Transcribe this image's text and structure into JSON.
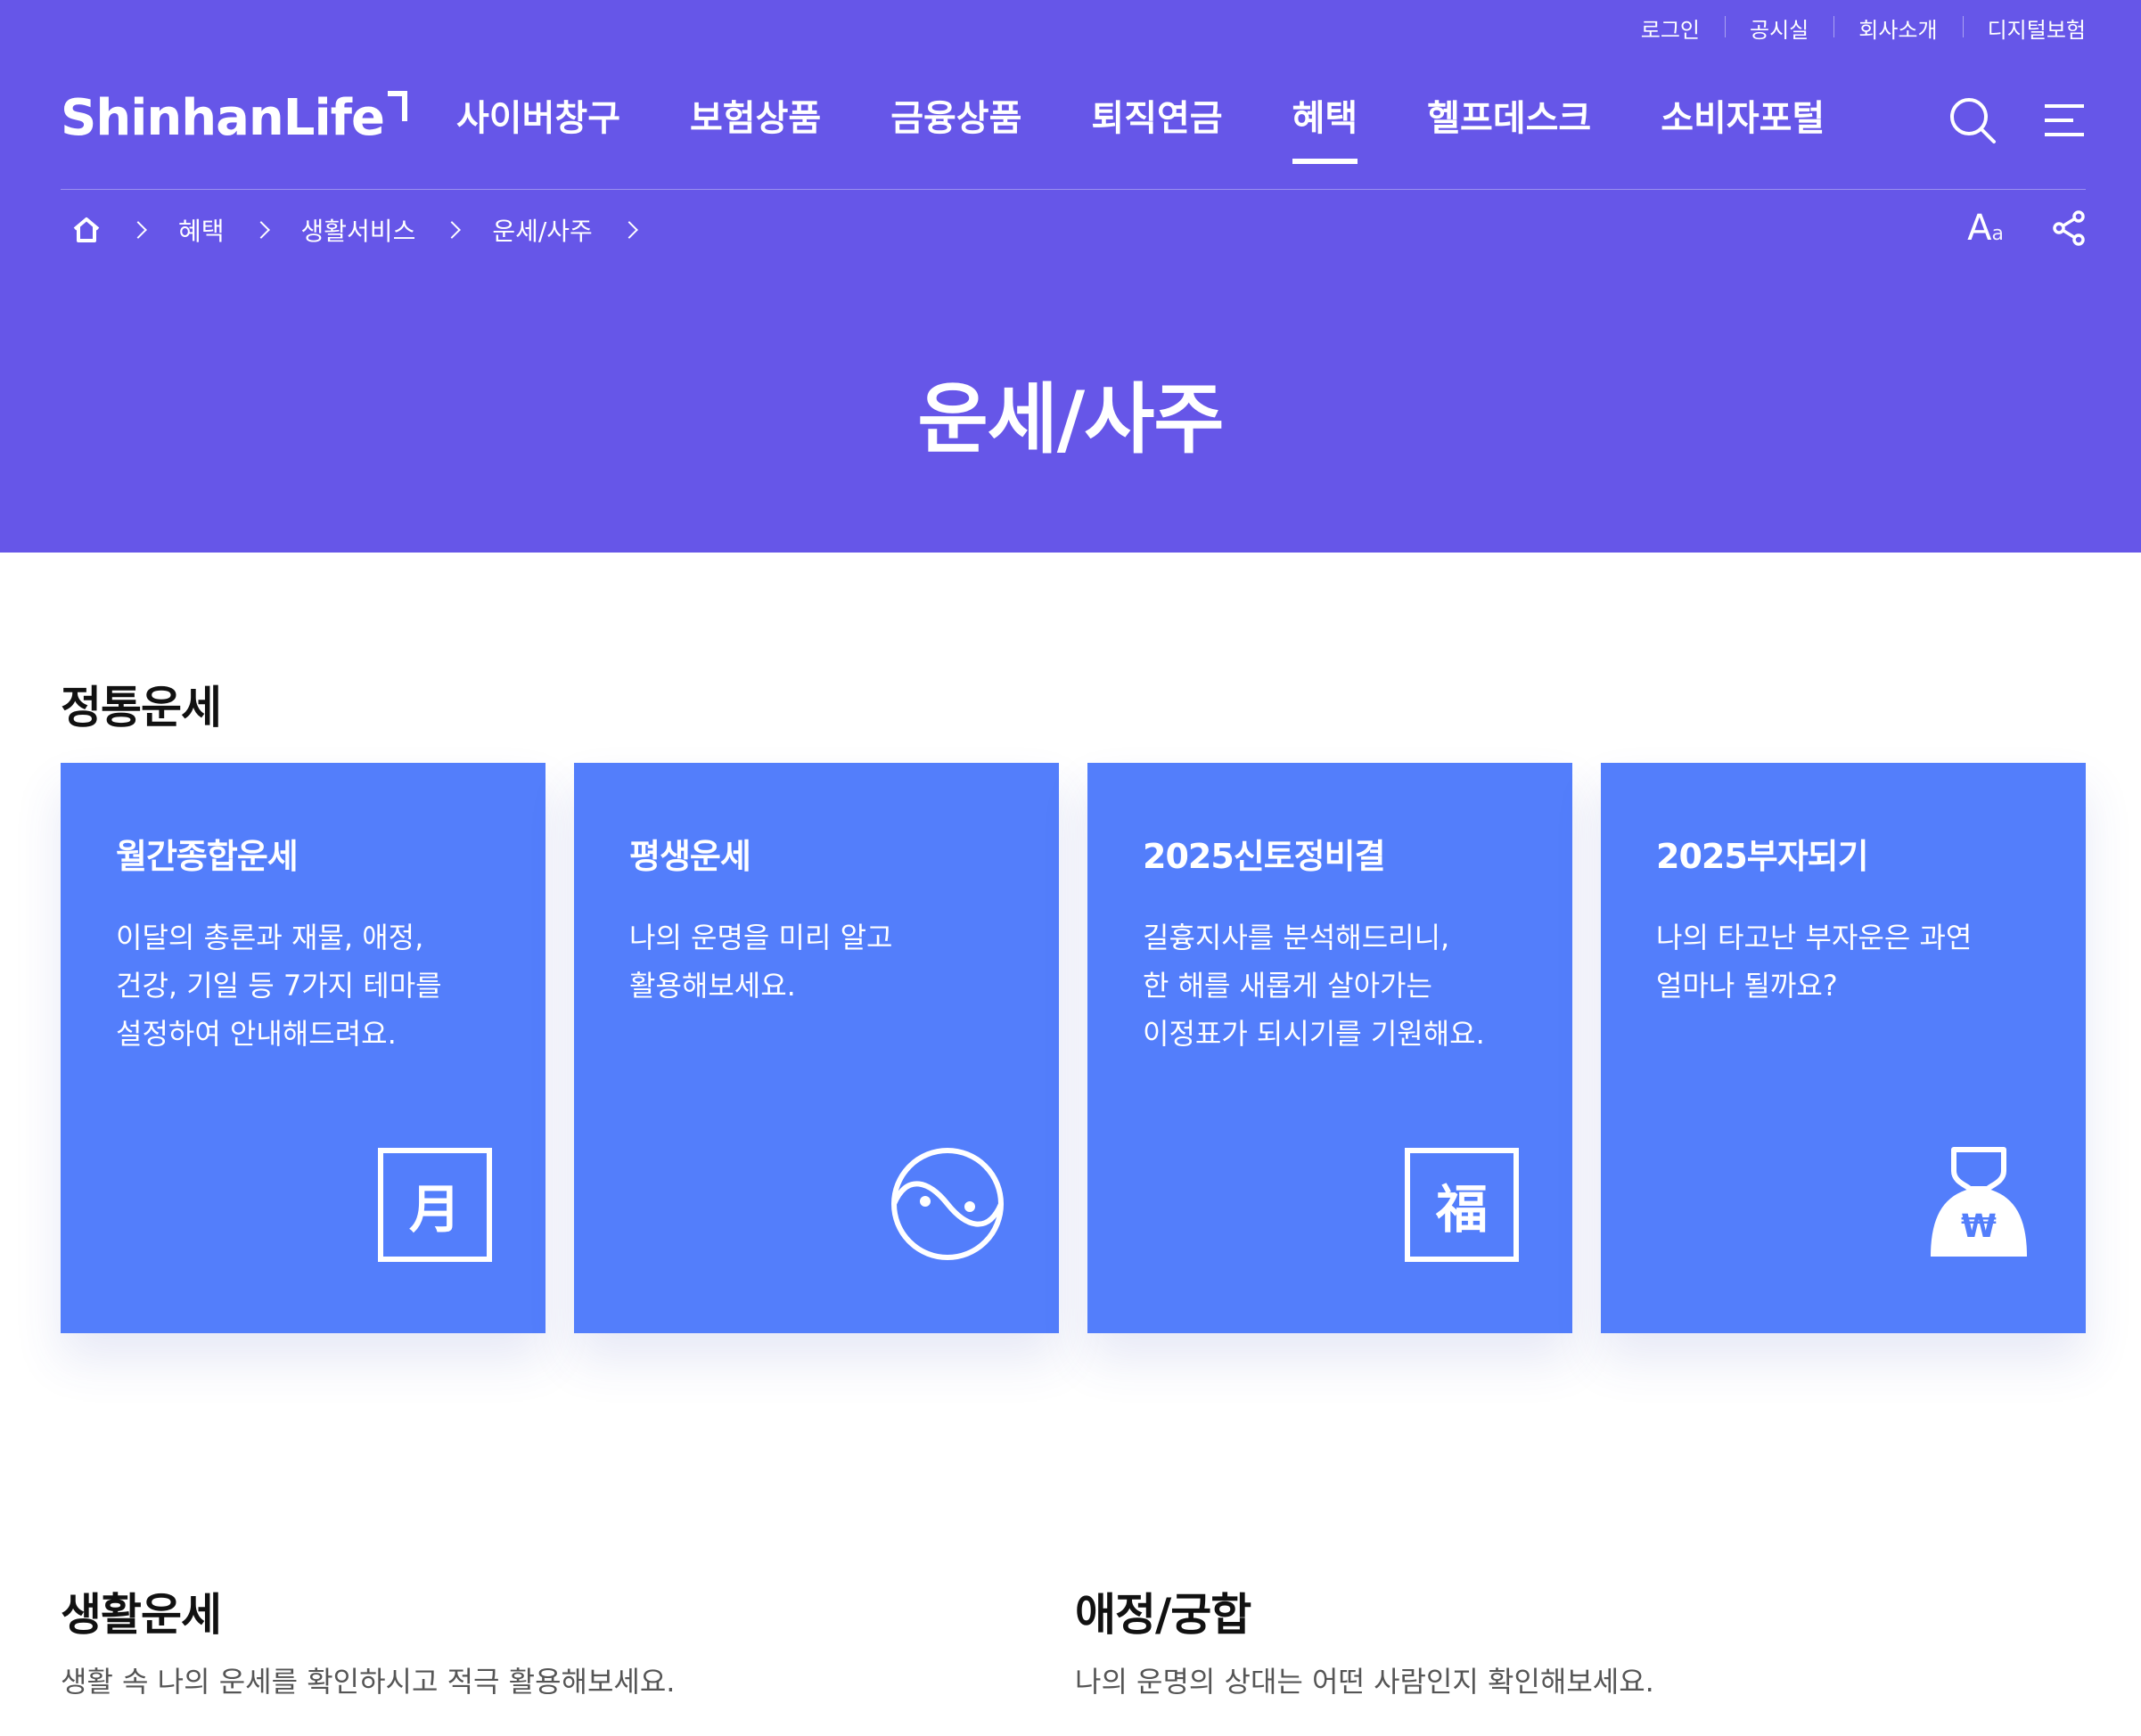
{
  "util_links": [
    "로그인",
    "공시실",
    "회사소개",
    "디지털보험"
  ],
  "logo": {
    "text": "ShinhanLife"
  },
  "nav": [
    {
      "label": "사이버창구",
      "active": false
    },
    {
      "label": "보험상품",
      "active": false
    },
    {
      "label": "금융상품",
      "active": false
    },
    {
      "label": "퇴직연금",
      "active": false
    },
    {
      "label": "혜택",
      "active": true
    },
    {
      "label": "헬프데스크",
      "active": false
    },
    {
      "label": "소비자포털",
      "active": false
    }
  ],
  "icons": {
    "search": "search-icon",
    "menu": "menu-icon",
    "home": "home-icon",
    "font_size": "font-size-icon",
    "share": "share-icon"
  },
  "breadcrumb": [
    "혜택",
    "생활서비스",
    "운세/사주"
  ],
  "font_size_label": {
    "big": "A",
    "small": "a"
  },
  "page_title": "운세/사주",
  "sections": {
    "traditional": {
      "title": "정통운세"
    },
    "life": {
      "title": "생활운세",
      "desc": "생활 속 나의 운세를 확인하시고 적극 활용해보세요."
    },
    "love": {
      "title": "애정/궁합",
      "desc": "나의 운명의 상대는 어떤 사람인지 확인해보세요."
    }
  },
  "cards": [
    {
      "title": "월간종합운세",
      "lines": [
        "이달의 총론과 재물, 애정,",
        "건강, 기일 등 7가지 테마를",
        "설정하여 안내해드려요."
      ],
      "icon": "moon-char-icon",
      "glyph": "月"
    },
    {
      "title": "평생운세",
      "lines": [
        "나의 운명을 미리 알고",
        "활용해보세요."
      ],
      "icon": "yin-yang-icon"
    },
    {
      "title": "2025신토정비결",
      "lines": [
        "길흉지사를 분석해드리니,",
        "한 해를 새롭게 살아가는",
        "이정표가 되시기를 기원해요."
      ],
      "icon": "fortune-char-icon",
      "glyph": "福"
    },
    {
      "title": "2025부자되기",
      "lines": [
        "나의 타고난 부자운은 과연",
        "얼마나 될까요?"
      ],
      "icon": "money-bag-icon",
      "glyph": "₩"
    }
  ],
  "colors": {
    "header_bg": "#6656e8",
    "card_bg": "#537efb"
  }
}
